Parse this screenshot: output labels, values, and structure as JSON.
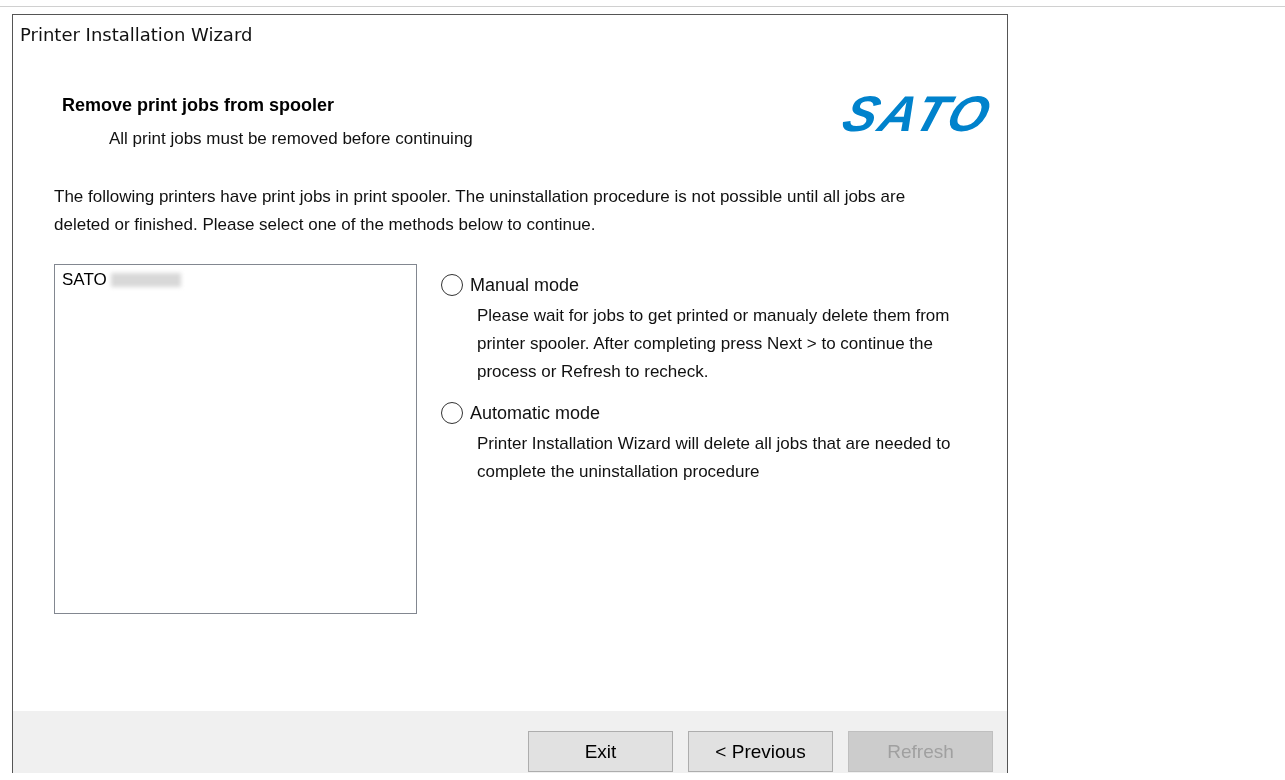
{
  "window": {
    "title": "Printer Installation Wizard"
  },
  "header": {
    "title": "Remove print jobs from spooler",
    "subtitle": "All print jobs must be removed before continuing",
    "logo": "SATO"
  },
  "intro": "The following printers have print jobs in print spooler. The uninstallation procedure is not possible until all jobs are deleted or finished. Please select one of the methods below to continue.",
  "printers": [
    {
      "name": "SATO",
      "redacted": true
    }
  ],
  "modes": [
    {
      "label": "Manual mode",
      "selected": false,
      "description": "Please wait for jobs to get printed or manualy delete them from printer spooler. After completing press Next > to continue the process or Refresh to recheck."
    },
    {
      "label": "Automatic mode",
      "selected": false,
      "description": "Printer Installation Wizard will delete all jobs that are needed to complete the uninstallation procedure"
    }
  ],
  "buttons": [
    {
      "label": "Exit",
      "disabled": false
    },
    {
      "label": "< Previous",
      "disabled": false
    },
    {
      "label": "Refresh",
      "disabled": true
    }
  ]
}
